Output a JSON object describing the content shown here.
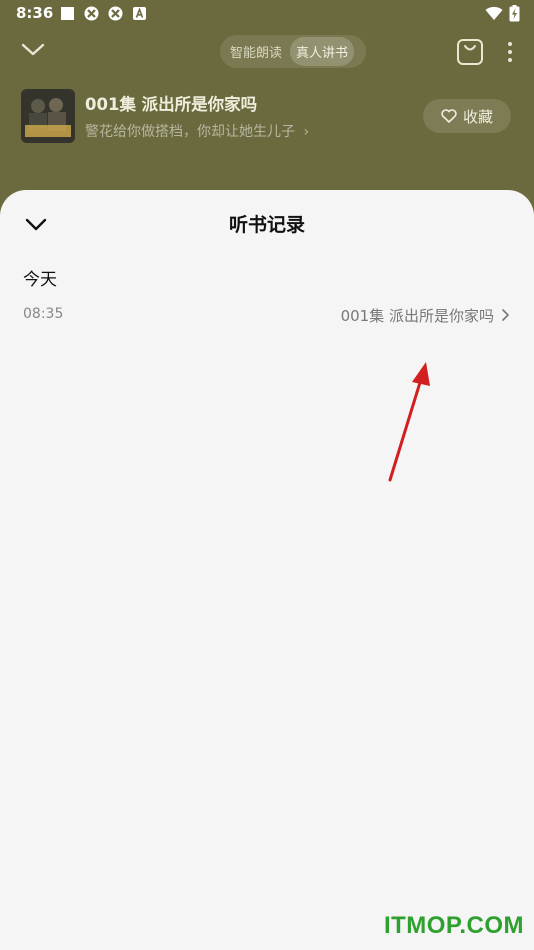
{
  "status_bar": {
    "time": "8:36"
  },
  "mode_toggle": {
    "options": [
      "智能朗读",
      "真人讲书"
    ],
    "active_index": 1
  },
  "now_playing": {
    "episode_title": "001集 派出所是你家吗",
    "book_subtitle": "警花给你做搭档，你却让她生儿子",
    "favorite_label": "收藏"
  },
  "history_sheet": {
    "title": "听书记录",
    "sections": [
      {
        "label": "今天",
        "items": [
          {
            "time": "08:35",
            "title": "001集 派出所是你家吗"
          }
        ]
      }
    ]
  },
  "watermark": "ITMOP.COM",
  "colors": {
    "header_bg": "#6b6a3e",
    "sheet_bg": "#f5f5f5",
    "annotation_arrow": "#d22020",
    "watermark": "#2ea02e"
  }
}
